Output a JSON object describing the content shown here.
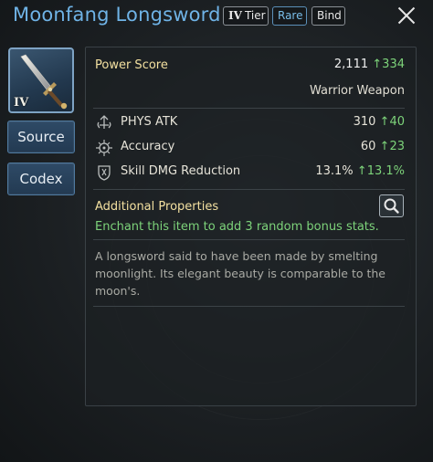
{
  "item": {
    "name": "Moonfang Longsword",
    "tier_roman": "IV",
    "tier_label": "Tier",
    "rarity": "Rare",
    "bind": "Bind",
    "icon_tier": "IV"
  },
  "sidebar": {
    "source_label": "Source",
    "codex_label": "Codex"
  },
  "power": {
    "label": "Power Score",
    "value": "2,111",
    "delta": "334",
    "weapon_type": "Warrior Weapon"
  },
  "stats": [
    {
      "name": "PHYS ATK",
      "value": "310",
      "delta": "40",
      "icon": "sword-crest-icon"
    },
    {
      "name": "Accuracy",
      "value": "60",
      "delta": "23",
      "icon": "target-icon"
    },
    {
      "name": "Skill DMG Reduction",
      "value": "13.1%",
      "delta": "13.1%",
      "icon": "shield-sword-icon"
    }
  ],
  "additional": {
    "title": "Additional Properties",
    "text": "Enchant this item to add 3 random bonus stats."
  },
  "description": "A longsword said to have been made by smelting moonlight. Its elegant beauty is comparable to the moon's.",
  "colors": {
    "title": "#6fb3e6",
    "gold_label": "#f3e0a0",
    "increase": "#7dd37a",
    "rare": "#79bde8"
  }
}
